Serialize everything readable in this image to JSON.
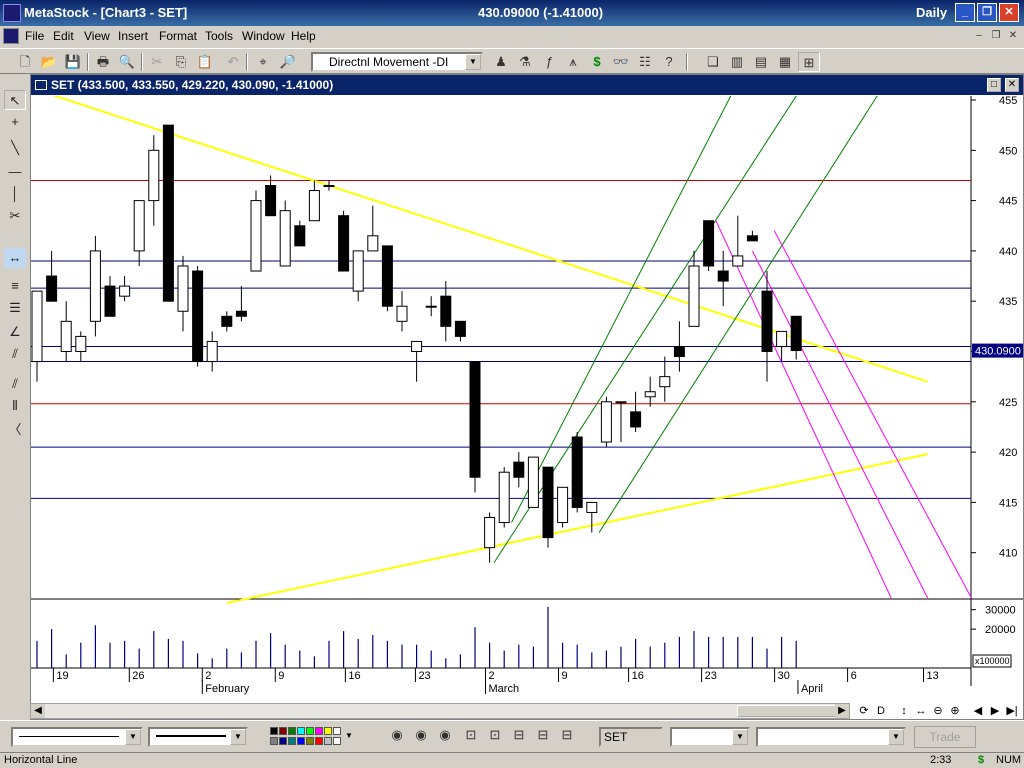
{
  "window": {
    "title": "MetaStock - [Chart3 - SET]",
    "price_summary": "430.09000 (-1.41000)",
    "periodicity": "Daily"
  },
  "menu": [
    "File",
    "Edit",
    "View",
    "Insert",
    "Format",
    "Tools",
    "Window",
    "Help"
  ],
  "toolbar": {
    "indicator_selected": "Directnl Movement -DI"
  },
  "chart": {
    "header": "SET (433.500, 433.550, 429.220, 430.090, -1.41000)",
    "last_price_label": "430.0900",
    "volume_multiplier": "x100000"
  },
  "chart_data": [
    {
      "type": "candlestick",
      "title": "SET",
      "y_axis_ticks": [
        455,
        450,
        445,
        440,
        435,
        430,
        425,
        420,
        415,
        410
      ],
      "ylim": [
        405,
        455
      ],
      "x_date_ticks": [
        "19",
        "26",
        "2",
        "9",
        "16",
        "23",
        "2",
        "9",
        "16",
        "23",
        "30",
        "6",
        "13"
      ],
      "month_labels": [
        "February",
        "March",
        "April"
      ],
      "candles": [
        {
          "o": 429.0,
          "h": 432.0,
          "l": 427.0,
          "c": 436.0
        },
        {
          "o": 437.5,
          "h": 440.0,
          "l": 435.0,
          "c": 435.0
        },
        {
          "o": 430.0,
          "h": 435.0,
          "l": 429.0,
          "c": 433.0
        },
        {
          "o": 430.0,
          "h": 432.0,
          "l": 429.0,
          "c": 431.5
        },
        {
          "o": 433.0,
          "h": 441.5,
          "l": 431.5,
          "c": 440.0
        },
        {
          "o": 436.5,
          "h": 437.5,
          "l": 433.5,
          "c": 433.5
        },
        {
          "o": 435.5,
          "h": 437.5,
          "l": 435.0,
          "c": 436.5
        },
        {
          "o": 440.0,
          "h": 441.5,
          "l": 438.5,
          "c": 445.0
        },
        {
          "o": 445.0,
          "h": 451.5,
          "l": 442.5,
          "c": 450.0
        },
        {
          "o": 452.5,
          "h": 452.5,
          "l": 435.0,
          "c": 435.0
        },
        {
          "o": 434.0,
          "h": 439.5,
          "l": 432.0,
          "c": 438.5
        },
        {
          "o": 438.0,
          "h": 438.5,
          "l": 428.5,
          "c": 429.0
        },
        {
          "o": 429.0,
          "h": 432.0,
          "l": 428.0,
          "c": 431.0
        },
        {
          "o": 433.5,
          "h": 434.0,
          "l": 432.0,
          "c": 432.5
        },
        {
          "o": 434.0,
          "h": 436.5,
          "l": 433.0,
          "c": 433.5
        },
        {
          "o": 438.0,
          "h": 446.0,
          "l": 438.0,
          "c": 445.0
        },
        {
          "o": 446.5,
          "h": 447.5,
          "l": 443.5,
          "c": 443.5
        },
        {
          "o": 438.5,
          "h": 445.0,
          "l": 438.5,
          "c": 444.0
        },
        {
          "o": 442.5,
          "h": 443.0,
          "l": 440.5,
          "c": 440.5
        },
        {
          "o": 443.0,
          "h": 447.0,
          "l": 443.0,
          "c": 446.0
        },
        {
          "o": 446.5,
          "h": 447.0,
          "l": 446.0,
          "c": 446.5
        },
        {
          "o": 443.5,
          "h": 444.0,
          "l": 438.0,
          "c": 438.0
        },
        {
          "o": 436.0,
          "h": 438.5,
          "l": 435.0,
          "c": 440.0
        },
        {
          "o": 440.0,
          "h": 444.5,
          "l": 440.0,
          "c": 441.5
        },
        {
          "o": 440.5,
          "h": 440.5,
          "l": 434.0,
          "c": 434.5
        },
        {
          "o": 433.0,
          "h": 436.0,
          "l": 432.0,
          "c": 434.5
        },
        {
          "o": 430.0,
          "h": 431.0,
          "l": 427.0,
          "c": 431.0
        },
        {
          "o": 434.5,
          "h": 435.5,
          "l": 433.5,
          "c": 434.5
        },
        {
          "o": 435.5,
          "h": 437.0,
          "l": 431.0,
          "c": 432.5
        },
        {
          "o": 433.0,
          "h": 433.0,
          "l": 431.0,
          "c": 431.5
        },
        {
          "o": 429.0,
          "h": 429.0,
          "l": 416.0,
          "c": 417.5
        },
        {
          "o": 410.5,
          "h": 414.0,
          "l": 409.0,
          "c": 413.5
        },
        {
          "o": 413.0,
          "h": 418.5,
          "l": 412.5,
          "c": 418.0
        },
        {
          "o": 419.0,
          "h": 420.0,
          "l": 416.5,
          "c": 417.5
        },
        {
          "o": 414.5,
          "h": 419.0,
          "l": 414.5,
          "c": 419.5
        },
        {
          "o": 418.5,
          "h": 418.5,
          "l": 410.5,
          "c": 411.5
        },
        {
          "o": 413.0,
          "h": 416.0,
          "l": 412.5,
          "c": 416.5
        },
        {
          "o": 421.5,
          "h": 422.0,
          "l": 414.0,
          "c": 414.5
        },
        {
          "o": 414.0,
          "h": 415.0,
          "l": 412.0,
          "c": 415.0
        },
        {
          "o": 421.0,
          "h": 425.5,
          "l": 420.5,
          "c": 425.0
        },
        {
          "o": 425.0,
          "h": 425.0,
          "l": 421.0,
          "c": 425.0
        },
        {
          "o": 424.0,
          "h": 426.0,
          "l": 422.0,
          "c": 422.5
        },
        {
          "o": 425.5,
          "h": 427.5,
          "l": 424.5,
          "c": 426.0
        },
        {
          "o": 426.5,
          "h": 429.5,
          "l": 425.0,
          "c": 427.5
        },
        {
          "o": 430.5,
          "h": 433.0,
          "l": 428.0,
          "c": 429.5
        },
        {
          "o": 432.5,
          "h": 440.0,
          "l": 432.5,
          "c": 438.5
        },
        {
          "o": 443.0,
          "h": 443.0,
          "l": 438.0,
          "c": 438.5
        },
        {
          "o": 438.0,
          "h": 440.0,
          "l": 434.5,
          "c": 437.0
        },
        {
          "o": 438.5,
          "h": 443.5,
          "l": 438.5,
          "c": 439.5
        },
        {
          "o": 441.5,
          "h": 442.0,
          "l": 441.0,
          "c": 441.0
        },
        {
          "o": 436.0,
          "h": 438.0,
          "l": 427.0,
          "c": 430.0
        },
        {
          "o": 430.5,
          "h": 432.0,
          "l": 429.0,
          "c": 432.0
        },
        {
          "o": 433.5,
          "h": 433.5,
          "l": 429.2,
          "c": 430.1
        }
      ],
      "horizontal_lines": [
        {
          "y": 447.0,
          "color": "#cc0000"
        },
        {
          "y": 439.0,
          "color": "#000080"
        },
        {
          "y": 436.3,
          "color": "#000080"
        },
        {
          "y": 430.5,
          "color": "#000080"
        },
        {
          "y": 429.0,
          "color": "#000080"
        },
        {
          "y": 424.8,
          "color": "#cc0000"
        },
        {
          "y": 420.5,
          "color": "#000080"
        },
        {
          "y": 415.4,
          "color": "#000080"
        }
      ]
    },
    {
      "type": "bar",
      "title": "Volume",
      "y_axis_ticks": [
        30000,
        20000
      ],
      "ylim": [
        0,
        35000
      ],
      "values": [
        14000,
        20000,
        7000,
        13000,
        22000,
        13000,
        14000,
        10000,
        19000,
        15000,
        14000,
        7500,
        5000,
        10000,
        8000,
        14000,
        18000,
        12000,
        9000,
        6000,
        14000,
        19000,
        15000,
        17000,
        14000,
        12000,
        12000,
        9000,
        5000,
        7000,
        21000,
        13000,
        9000,
        12000,
        11000,
        31500,
        13000,
        12000,
        8000,
        9000,
        11000,
        15000,
        11000,
        13000,
        16000,
        19000,
        16000,
        16000,
        16000,
        16000,
        10000,
        16000,
        14000
      ]
    }
  ],
  "bottombar": {
    "symbol": "SET",
    "trade_label": "Trade"
  },
  "status": {
    "left": "Horizontal Line",
    "time": "2:33",
    "currency": "$",
    "num": "NUM"
  },
  "colors": {
    "trendline": "#ffff00",
    "channel": "#008000",
    "downchannel": "#ff00ff",
    "resistance": "#cc0000",
    "support": "#000080"
  }
}
